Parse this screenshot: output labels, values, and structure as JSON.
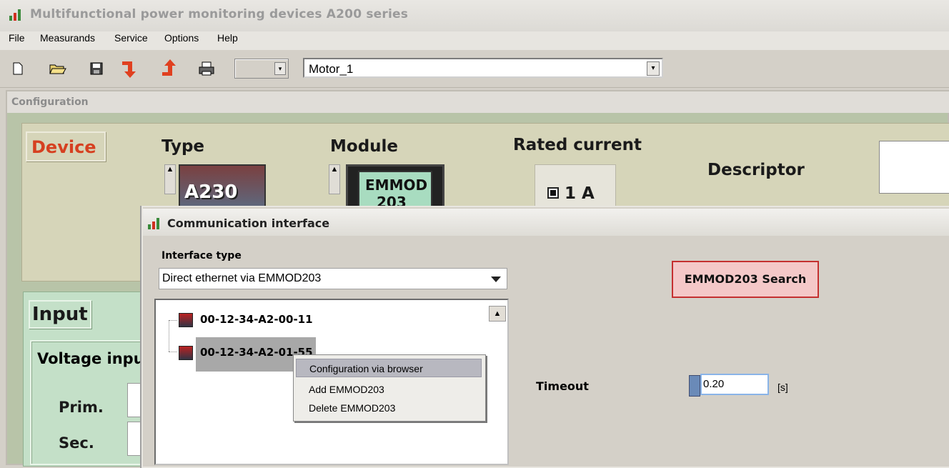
{
  "window": {
    "title": "Multifunctional power monitoring devices A200 series"
  },
  "menu": [
    {
      "label": "File"
    },
    {
      "label": "Measurands"
    },
    {
      "label": "Service"
    },
    {
      "label": "Options"
    },
    {
      "label": "Help"
    }
  ],
  "toolbar": {
    "profile_selected": "Motor_1",
    "icons": [
      "new-file-icon",
      "open-folder-icon",
      "save-icon",
      "download-icon",
      "upload-icon",
      "print-icon"
    ]
  },
  "config": {
    "title": "Configuration",
    "device_label": "Device",
    "type_label": "Type",
    "type_value": "A230",
    "module_label": "Module",
    "module_value_line1": "EMMOD",
    "module_value_line2": "203",
    "rated_current_label": "Rated current",
    "rated_current_value": "1 A",
    "descriptor_label": "Descriptor",
    "input_label": "Input",
    "voltage_input_label": "Voltage input",
    "prim_label": "Prim.",
    "sec_label": "Sec."
  },
  "dialog": {
    "title": "Communication interface",
    "interface_type_label": "Interface type",
    "interface_type_value": "Direct ethernet via EMMOD203",
    "search_button": "EMMOD203 Search",
    "devices": [
      {
        "mac": "00-12-34-A2-00-11"
      },
      {
        "mac": "00-12-34-A2-01-55"
      }
    ],
    "context_menu": [
      {
        "label": "Configuration via browser"
      },
      {
        "label": "Add EMMOD203"
      },
      {
        "label": "Delete EMMOD203"
      }
    ],
    "timeout_label": "Timeout",
    "timeout_value": "0.20",
    "timeout_unit": "[s]"
  },
  "colors": {
    "device_label": "#d64020",
    "device_panel": "#d6d5b9",
    "input_panel": "#c4e0c8",
    "search_button_bg": "#f4c8c8",
    "search_button_border": "#c43030"
  }
}
